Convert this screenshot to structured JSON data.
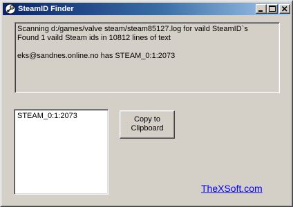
{
  "window": {
    "title": "SteamID Finder",
    "app_icon": "steam-logo-icon",
    "controls": [
      "minimize-icon",
      "maximize-icon",
      "close-icon"
    ]
  },
  "log": {
    "lines": [
      "Scanning d:/games/valve steam/steam85127.log for vaild SteamID`s",
      "Found 1 vaild Steam ids in 10812 lines of text",
      "",
      "eks@sandnes.online.no has STEAM_0:1:2073"
    ]
  },
  "id_list": {
    "items": [
      "STEAM_0:1:2073"
    ]
  },
  "copy_button": {
    "line1": "Copy to",
    "line2": "Clipboard"
  },
  "footer": {
    "link_text": "TheXSoft.com"
  },
  "colors": {
    "titlebar_start": "#0a246a",
    "titlebar_end": "#a6caf0",
    "face": "#d4d0c8",
    "link": "#0000ff"
  }
}
